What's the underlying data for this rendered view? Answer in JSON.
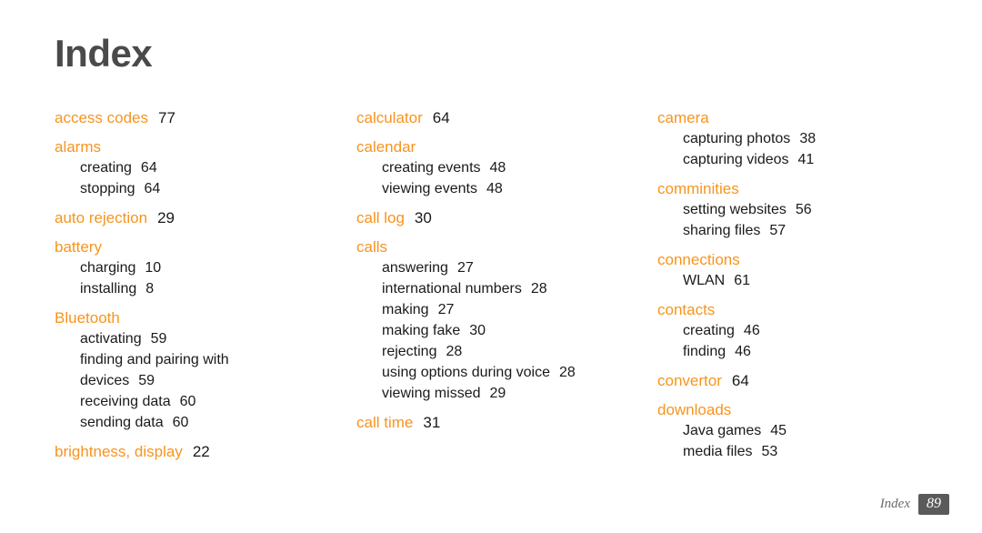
{
  "title": "Index",
  "colors": {
    "accent": "#F7941E",
    "title": "#4a4a4a",
    "text": "#1a1a1a",
    "badge_bg": "#5a5a5a",
    "footer_text": "#6b6b6b"
  },
  "columns": [
    {
      "entries": [
        {
          "term": "access codes",
          "page": "77",
          "subs": []
        },
        {
          "term": "alarms",
          "page": "",
          "subs": [
            {
              "label": "creating",
              "page": "64"
            },
            {
              "label": "stopping",
              "page": "64"
            }
          ]
        },
        {
          "term": "auto rejection",
          "page": "29",
          "subs": []
        },
        {
          "term": "battery",
          "page": "",
          "subs": [
            {
              "label": "charging",
              "page": "10"
            },
            {
              "label": "installing",
              "page": "8"
            }
          ]
        },
        {
          "term": "Bluetooth",
          "page": "",
          "subs": [
            {
              "label": "activating",
              "page": "59"
            },
            {
              "label": "finding and pairing with devices",
              "page": "59",
              "wrap": true
            },
            {
              "label": "receiving data",
              "page": "60"
            },
            {
              "label": "sending data",
              "page": "60"
            }
          ]
        },
        {
          "term": "brightness, display",
          "page": "22",
          "subs": []
        }
      ]
    },
    {
      "entries": [
        {
          "term": "calculator",
          "page": "64",
          "subs": []
        },
        {
          "term": "calendar",
          "page": "",
          "subs": [
            {
              "label": "creating events",
              "page": "48"
            },
            {
              "label": "viewing events",
              "page": "48"
            }
          ]
        },
        {
          "term": "call log",
          "page": "30",
          "subs": []
        },
        {
          "term": "calls",
          "page": "",
          "subs": [
            {
              "label": "answering",
              "page": "27"
            },
            {
              "label": "international numbers",
              "page": "28"
            },
            {
              "label": "making",
              "page": "27"
            },
            {
              "label": "making fake",
              "page": "30"
            },
            {
              "label": "rejecting",
              "page": "28"
            },
            {
              "label": "using options during voice",
              "page": "28"
            },
            {
              "label": "viewing missed",
              "page": "29"
            }
          ]
        },
        {
          "term": "call time",
          "page": "31",
          "subs": []
        }
      ]
    },
    {
      "entries": [
        {
          "term": "camera",
          "page": "",
          "subs": [
            {
              "label": "capturing photos",
              "page": "38"
            },
            {
              "label": "capturing videos",
              "page": "41"
            }
          ]
        },
        {
          "term": "comminities",
          "page": "",
          "subs": [
            {
              "label": "setting websites",
              "page": "56"
            },
            {
              "label": "sharing files",
              "page": "57"
            }
          ]
        },
        {
          "term": "connections",
          "page": "",
          "subs": [
            {
              "label": "WLAN",
              "page": "61"
            }
          ]
        },
        {
          "term": "contacts",
          "page": "",
          "subs": [
            {
              "label": "creating",
              "page": "46"
            },
            {
              "label": "finding",
              "page": "46"
            }
          ]
        },
        {
          "term": "convertor",
          "page": "64",
          "subs": []
        },
        {
          "term": "downloads",
          "page": "",
          "subs": [
            {
              "label": "Java games",
              "page": "45"
            },
            {
              "label": "media files",
              "page": "53"
            }
          ]
        }
      ]
    }
  ],
  "footer": {
    "label": "Index",
    "page_number": "89"
  }
}
